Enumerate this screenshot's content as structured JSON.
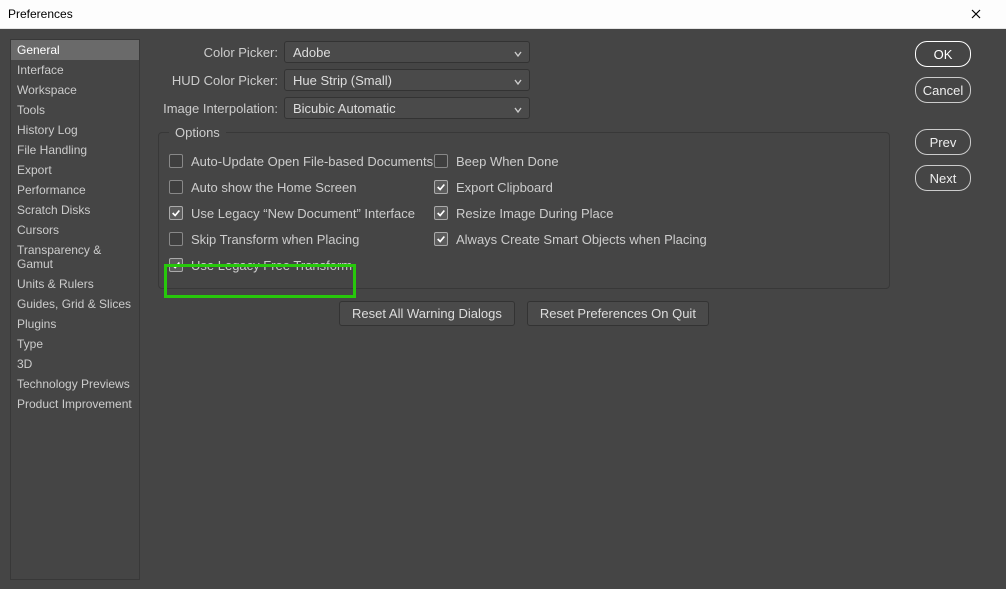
{
  "title": "Preferences",
  "sidebar": {
    "items": [
      "General",
      "Interface",
      "Workspace",
      "Tools",
      "History Log",
      "File Handling",
      "Export",
      "Performance",
      "Scratch Disks",
      "Cursors",
      "Transparency & Gamut",
      "Units & Rulers",
      "Guides, Grid & Slices",
      "Plugins",
      "Type",
      "3D",
      "Technology Previews",
      "Product Improvement"
    ],
    "selected": 0
  },
  "main": {
    "rows": {
      "colorPicker": {
        "label": "Color Picker:",
        "value": "Adobe"
      },
      "hudColorPicker": {
        "label": "HUD Color Picker:",
        "value": "Hue Strip (Small)"
      },
      "imageInterpolation": {
        "label": "Image Interpolation:",
        "value": "Bicubic Automatic"
      }
    },
    "optionsLegend": "Options",
    "optionsLeft": [
      {
        "label": "Auto-Update Open File-based Documents",
        "checked": false
      },
      {
        "label": "Auto show the Home Screen",
        "checked": false
      },
      {
        "label": "Use Legacy “New Document” Interface",
        "checked": true
      },
      {
        "label": "Skip Transform when Placing",
        "checked": false
      },
      {
        "label": "Use Legacy Free Transform",
        "checked": true
      }
    ],
    "optionsRight": [
      {
        "label": "Beep When Done",
        "checked": false
      },
      {
        "label": "Export Clipboard",
        "checked": true
      },
      {
        "label": "Resize Image During Place",
        "checked": true
      },
      {
        "label": "Always Create Smart Objects when Placing",
        "checked": true
      }
    ],
    "resetWarning": "Reset All Warning Dialogs",
    "resetPrefs": "Reset Preferences On Quit"
  },
  "buttons": {
    "ok": "OK",
    "cancel": "Cancel",
    "prev": "Prev",
    "next": "Next"
  },
  "highlightIndex": 4
}
